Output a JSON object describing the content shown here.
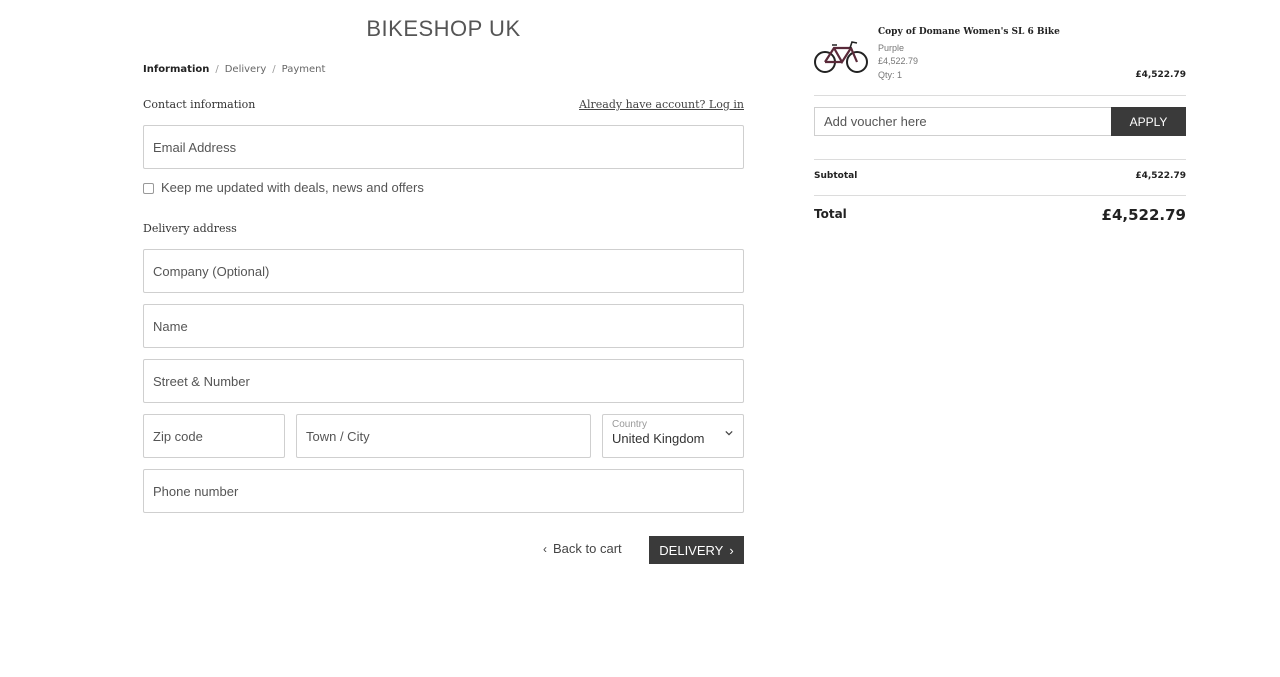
{
  "shop_title": "BIKESHOP UK",
  "breadcrumb": {
    "steps": [
      "Information",
      "Delivery",
      "Payment"
    ],
    "separator": "/"
  },
  "contact": {
    "heading": "Contact information",
    "login_link": "Already have account? Log in",
    "email_placeholder": "Email Address",
    "newsletter_label": "Keep me updated with deals, news and offers"
  },
  "delivery": {
    "heading": "Delivery address",
    "company_placeholder": "Company (Optional)",
    "name_placeholder": "Name",
    "street_placeholder": "Street & Number",
    "zip_placeholder": "Zip code",
    "city_placeholder": "Town / City",
    "country_label": "Country",
    "country_value": "United Kingdom",
    "phone_placeholder": "Phone number"
  },
  "actions": {
    "back_label": "Back to cart",
    "back_arrow": "‹",
    "next_label": "DELIVERY",
    "next_arrow": "›"
  },
  "cart": {
    "item": {
      "name": "Copy of Domane Women's SL 6 Bike",
      "variant": "Purple",
      "unit_price": "£4,522.79",
      "qty": "Qty: 1",
      "line_total": "£4,522.79",
      "image_icon": "bike-icon"
    },
    "voucher_placeholder": "Add voucher here",
    "apply_label": "APPLY",
    "subtotal_label": "Subtotal",
    "subtotal_value": "£4,522.79",
    "total_label": "Total",
    "total_value": "£4,522.79"
  },
  "colors": {
    "button_bg": "#3a3a3a",
    "border": "#cfcfcf",
    "text": "#333333"
  }
}
